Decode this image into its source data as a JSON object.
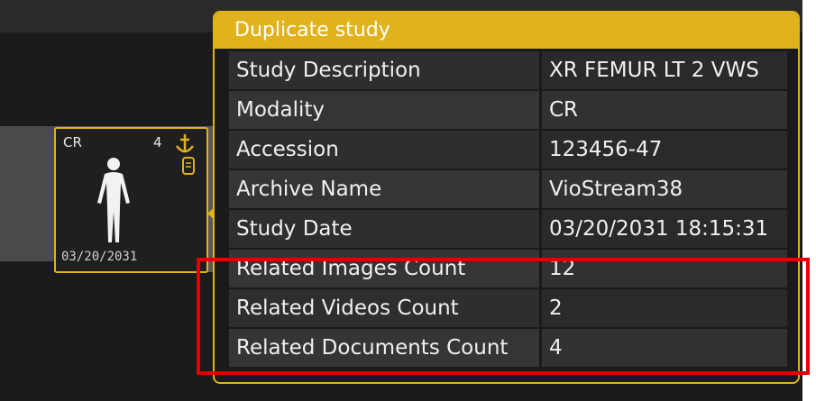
{
  "thumbnail": {
    "modality": "CR",
    "count": "4",
    "date": "03/20/2031",
    "icons": [
      "person-silhouette-icon",
      "anchor-icon",
      "document-icon"
    ]
  },
  "popup": {
    "title": "Duplicate study",
    "rows": [
      {
        "label": "Study Description",
        "value": "XR FEMUR LT 2 VWS"
      },
      {
        "label": "Modality",
        "value": "CR"
      },
      {
        "label": "Accession",
        "value": "123456-47"
      },
      {
        "label": "Archive Name",
        "value": "VioStream38"
      },
      {
        "label": "Study Date",
        "value": "03/20/2031 18:15:31"
      },
      {
        "label": "Related Images Count",
        "value": "12"
      },
      {
        "label": "Related Videos Count",
        "value": "2"
      },
      {
        "label": "Related Documents Count",
        "value": "4"
      }
    ]
  },
  "colors": {
    "accent": "#e0b21c",
    "highlight": "#e00000",
    "background": "#1b1b1b"
  }
}
